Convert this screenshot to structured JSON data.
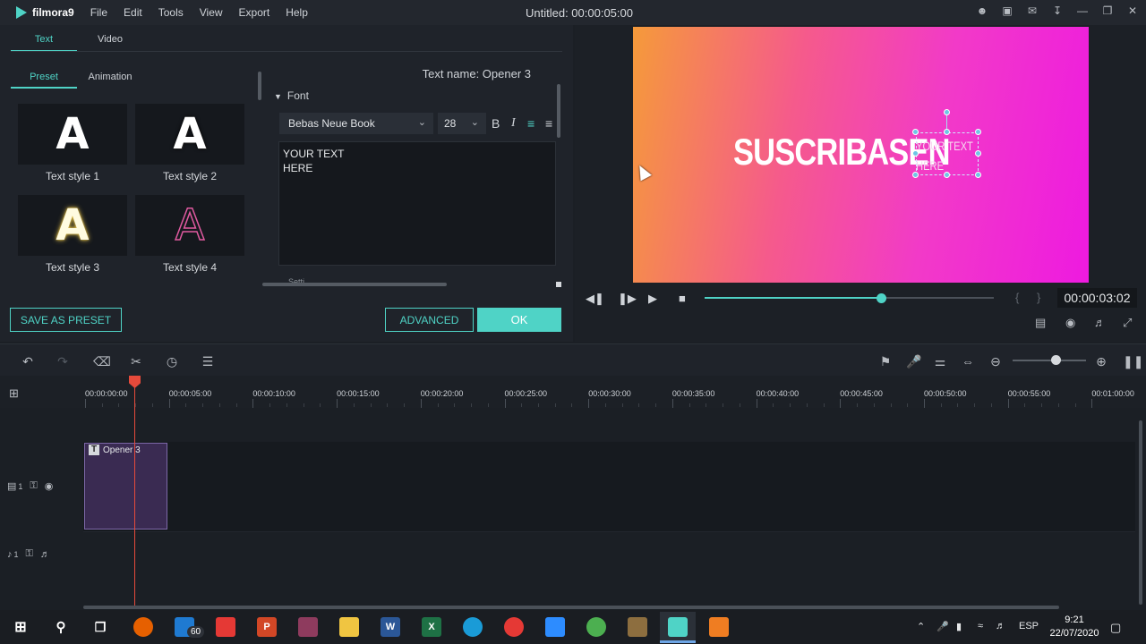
{
  "app": {
    "name": "filmora9",
    "menu": [
      "File",
      "Edit",
      "Tools",
      "View",
      "Export",
      "Help"
    ],
    "window_title": "Untitled: 00:00:05:00"
  },
  "editor": {
    "tabs": [
      "Text",
      "Video"
    ],
    "subtabs": [
      "Preset",
      "Animation"
    ],
    "text_name": "Text name: Opener 3",
    "styles": [
      {
        "glyph": "A",
        "label": "Text style 1"
      },
      {
        "glyph": "A",
        "label": "Text style 2"
      },
      {
        "glyph": "A",
        "label": "Text style 3"
      },
      {
        "glyph": "A",
        "label": "Text style 4"
      }
    ],
    "font_section": "Font",
    "font_family": "Bebas Neue Book",
    "font_size": "28",
    "bold": "B",
    "italic": "I",
    "text_value": "YOUR TEXT\nHERE",
    "cut_label": "Setti",
    "save_preset": "SAVE AS PRESET",
    "advanced": "ADVANCED",
    "ok": "OK"
  },
  "preview": {
    "main_text": "SUSCRIBASEN",
    "overlay_text": "YOUR TEXT\nHERE",
    "timecode": "00:00:03:02",
    "braces": "{ }",
    "progress": 0.61
  },
  "timeline": {
    "ruler": [
      "00:00:00:00",
      "00:00:05:00",
      "00:00:10:00",
      "00:00:15:00",
      "00:00:20:00",
      "00:00:25:00",
      "00:00:30:00",
      "00:00:35:00",
      "00:00:40:00",
      "00:00:45:00",
      "00:00:50:00",
      "00:00:55:00",
      "00:01:00:00"
    ],
    "clip_label": "Opener 3",
    "video_track_num": "1",
    "audio_track_num": "1"
  },
  "taskbar": {
    "mail_badge": "60",
    "language": "ESP",
    "time": "9:21",
    "date": "22/07/2020"
  },
  "colors": {
    "accent": "#4fd3c6",
    "playhead": "#e64a3b",
    "clip": "#3a2b52"
  }
}
